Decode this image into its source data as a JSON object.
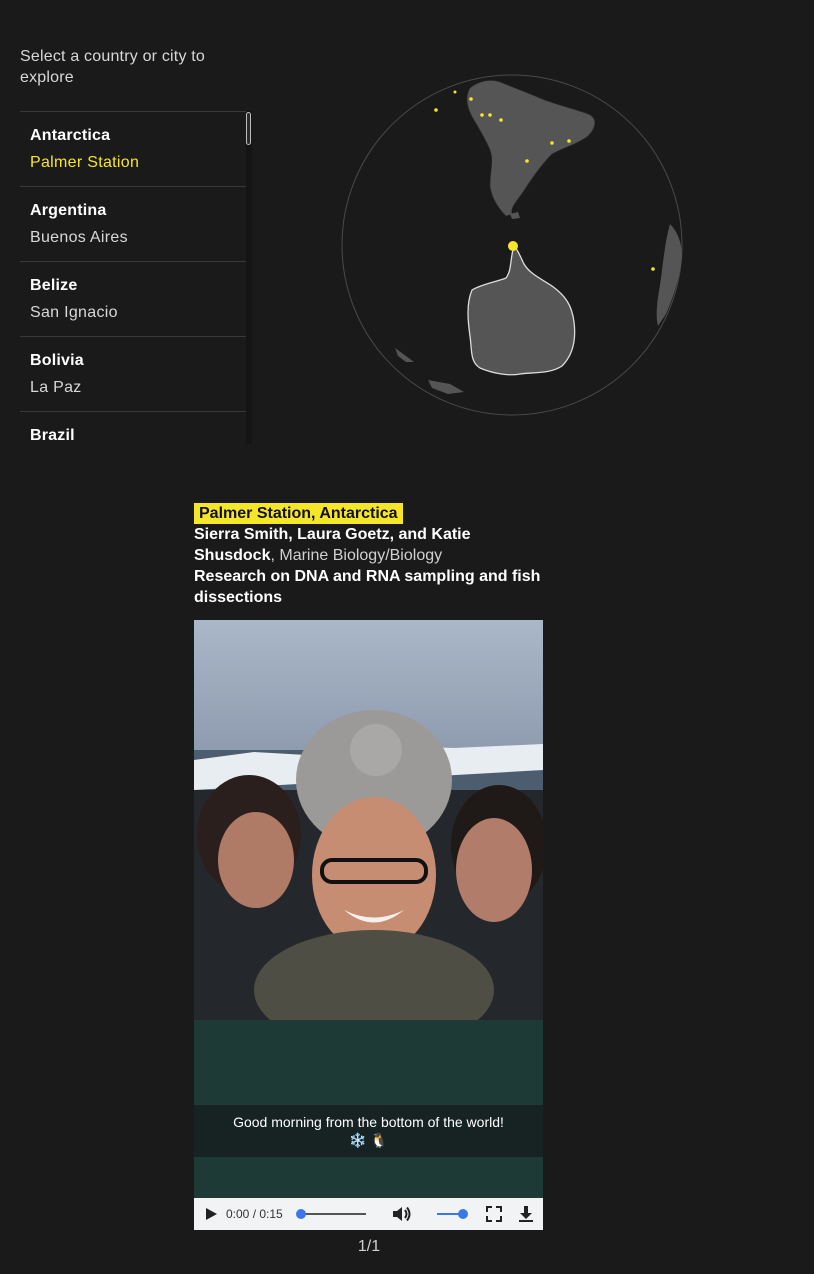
{
  "sidebar": {
    "prompt": "Select a country or city to explore",
    "items": [
      {
        "country": "Antarctica",
        "city": "Palmer Station",
        "active": true
      },
      {
        "country": "Argentina",
        "city": "Buenos Aires"
      },
      {
        "country": "Belize",
        "city": "San Ignacio"
      },
      {
        "country": "Bolivia",
        "city": "La Paz"
      },
      {
        "country": "Brazil",
        "city": ""
      }
    ]
  },
  "colors": {
    "background": "#1a1a1a",
    "accent": "#f5e62a",
    "land": "#555555"
  },
  "story": {
    "location": "Palmer Station, Antarctica",
    "names": "Sierra Smith, Laura Goetz, and Katie Shusdock",
    "field": ", Marine Biology/Biology",
    "research": "Research on DNA and RNA sampling and fish dissections"
  },
  "video": {
    "caption": "Good morning from the bottom of the world!",
    "caption_emoji": "❄️ 🐧",
    "time": "0:00 / 0:15",
    "progress": 0,
    "volume": 1.0,
    "icons": [
      "play-icon",
      "volume-icon",
      "fullscreen-icon",
      "download-icon"
    ]
  },
  "pager": "1/1"
}
